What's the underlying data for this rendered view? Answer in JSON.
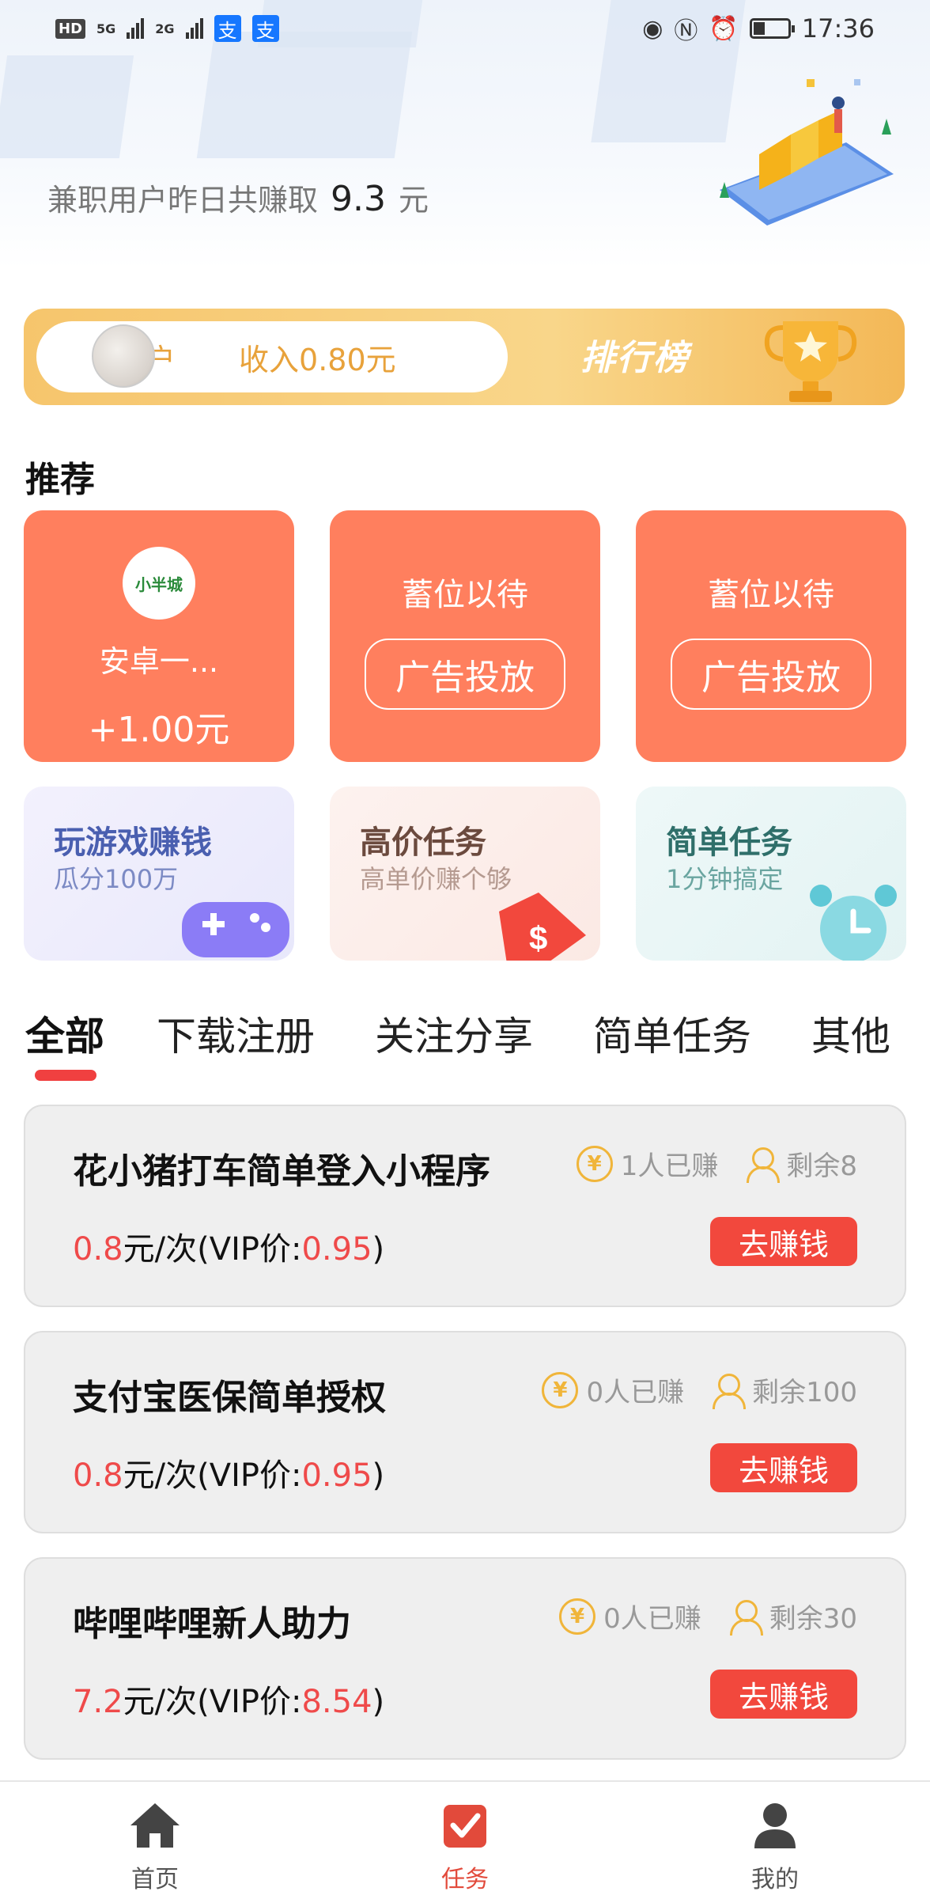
{
  "status_bar": {
    "left_badges": [
      "HD",
      "5G",
      "2G"
    ],
    "alipay_icons": [
      "支",
      "支"
    ],
    "time": "17:36"
  },
  "hero": {
    "earn_prefix": "兼职用户昨日共赚取",
    "earn_amount": "9.3",
    "earn_unit": "元"
  },
  "rank_bar": {
    "user": "用户",
    "income": "收入0.80元",
    "title": "排行榜"
  },
  "recommend": {
    "title": "推荐",
    "cards": [
      {
        "name": "安卓一...",
        "reward": "+1.00元",
        "logo_text": "小半城"
      },
      {
        "wait": "蓄位以待",
        "button": "广告投放"
      },
      {
        "wait": "蓄位以待",
        "button": "广告投放"
      }
    ]
  },
  "categories": [
    {
      "title": "玩游戏赚钱",
      "subtitle": "瓜分100万",
      "title_color": "#4a5fb0",
      "sub_color": "#7c8ac4",
      "icon": "gamepad-icon"
    },
    {
      "title": "高价任务",
      "subtitle": "高单价赚个够",
      "title_color": "#6b4a3e",
      "sub_color": "#b59a90",
      "icon": "price-tag-icon"
    },
    {
      "title": "简单任务",
      "subtitle": "1分钟搞定",
      "title_color": "#2f6f6a",
      "sub_color": "#6aa5a0",
      "icon": "alarm-clock-icon"
    }
  ],
  "tabs": [
    {
      "label": "全部",
      "active": true
    },
    {
      "label": "下载注册"
    },
    {
      "label": "关注分享"
    },
    {
      "label": "简单任务"
    },
    {
      "label": "其他"
    }
  ],
  "tasks": [
    {
      "title": "花小猪打车简单登入小程序",
      "earned": "1人已赚",
      "remaining": "剩余8",
      "price": "0.8",
      "price_suffix": "元/次(VIP价:",
      "vip_price": "0.95",
      "close": ")",
      "button": "去赚钱"
    },
    {
      "title": "支付宝医保简单授权",
      "earned": "0人已赚",
      "remaining": "剩余100",
      "price": "0.8",
      "price_suffix": "元/次(VIP价:",
      "vip_price": "0.95",
      "close": ")",
      "button": "去赚钱"
    },
    {
      "title": "哔哩哔哩新人助力",
      "earned": "0人已赚",
      "remaining": "剩余30",
      "price": "7.2",
      "price_suffix": "元/次(VIP价:",
      "vip_price": "8.54",
      "close": ")",
      "button": "去赚钱"
    }
  ],
  "bottom_nav": [
    {
      "label": "首页",
      "icon": "home-icon"
    },
    {
      "label": "任务",
      "icon": "task-check-icon",
      "active": true
    },
    {
      "label": "我的",
      "icon": "profile-icon"
    }
  ],
  "coin_glyph": "¥",
  "colors": {
    "accent": "#f2483d",
    "card": "#ff7f5e",
    "gold": "#f0b53a"
  }
}
